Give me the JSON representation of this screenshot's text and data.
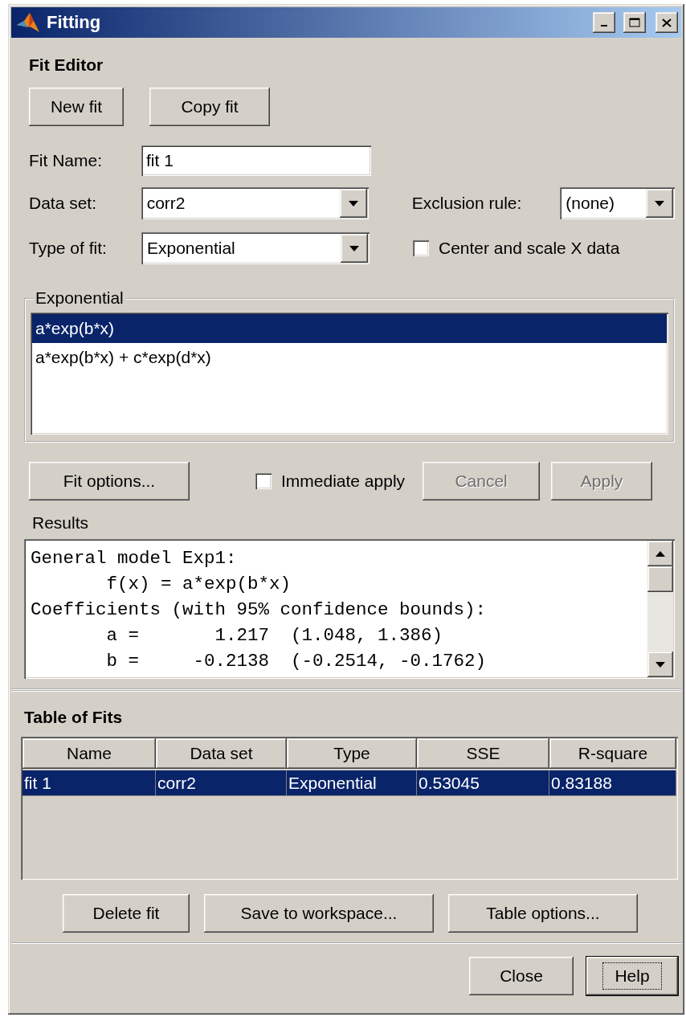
{
  "window": {
    "title": "Fitting"
  },
  "fit_editor": {
    "title": "Fit Editor",
    "buttons": [
      {
        "label": "New fit"
      },
      {
        "label": "Copy fit"
      }
    ],
    "fit_name": {
      "label": "Fit Name:",
      "value": "fit 1"
    },
    "data_set": {
      "label": "Data set:",
      "value": "corr2"
    },
    "exclusion_rule": {
      "label": "Exclusion rule:",
      "value": "(none)"
    },
    "type_of_fit": {
      "label": "Type of fit:",
      "value": "Exponential"
    },
    "center_scale": {
      "label": "Center and scale X data",
      "checked": false
    },
    "equations": {
      "title": "Exponential",
      "items": [
        {
          "text": "a*exp(b*x)",
          "selected": true
        },
        {
          "text": "a*exp(b*x) + c*exp(d*x)",
          "selected": false
        }
      ]
    },
    "fit_options_button": {
      "label": "Fit options..."
    },
    "immediate_apply": {
      "label": "Immediate apply",
      "checked": false
    },
    "action_buttons": [
      {
        "label": "Cancel",
        "disabled": true
      },
      {
        "label": "Apply",
        "disabled": true
      }
    ],
    "results": {
      "title": "Results",
      "lines": [
        "General model Exp1:",
        "       f(x) = a*exp(b*x)",
        "Coefficients (with 95% confidence bounds):",
        "       a =       1.217  (1.048, 1.386)",
        "       b =     -0.2138  (-0.2514, -0.1762)"
      ]
    }
  },
  "table_of_fits": {
    "title": "Table of Fits",
    "columns": [
      "Name",
      "Data set",
      "Type",
      "SSE",
      "R-square"
    ],
    "rows": [
      {
        "cells": [
          "fit 1",
          "corr2",
          "Exponential",
          "0.53045",
          "0.83188"
        ],
        "selected": true
      }
    ],
    "buttons": [
      {
        "label": "Delete fit"
      },
      {
        "label": "Save to workspace..."
      },
      {
        "label": "Table options..."
      }
    ]
  },
  "footer_buttons": [
    {
      "label": "Close",
      "focused": false
    },
    {
      "label": "Help",
      "focused": true
    }
  ]
}
